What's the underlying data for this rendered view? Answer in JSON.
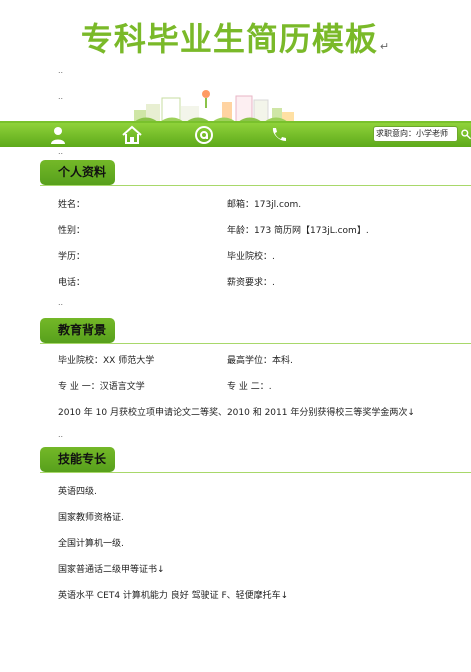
{
  "title": "专科毕业生简历模板",
  "marks": {
    "paragraph": "↵",
    "small": ".."
  },
  "header": {
    "nav_icons": [
      "person-icon",
      "home-icon",
      "at-icon",
      "phone-icon",
      "search-icon"
    ],
    "search_text": "求职意向：小学老师"
  },
  "sections": {
    "personal": {
      "heading": "个人资料",
      "rows": [
        {
          "left": "姓名：",
          "right": "邮箱：173jl.com."
        },
        {
          "left": "性别：",
          "right": "年龄：173 简历网【173jL.com】."
        },
        {
          "left": "学历：",
          "right": "毕业院校：."
        },
        {
          "left": "电话：",
          "right": "薪资要求：."
        }
      ]
    },
    "education": {
      "heading": "教育背景",
      "rows": [
        {
          "left": "毕业院校：XX 师范大学",
          "right": "最高学位：本科."
        },
        {
          "left": "专 业 一：汉语言文学",
          "right": "专 业 二：."
        }
      ],
      "note": "2010 年 10 月获校立项申请论文二等奖、2010 和 2011 年分别获得校三等奖学金两次↓"
    },
    "skills": {
      "heading": "技能专长",
      "items": [
        "英语四级.",
        "国家教师资格证.",
        "全国计算机一级.",
        "国家普通话二级甲等证书↓",
        "英语水平 CET4 计算机能力 良好 驾驶证 F、轻便摩托车↓"
      ]
    }
  },
  "colors": {
    "accent": "#7ab929",
    "bar": "#5da91a"
  }
}
